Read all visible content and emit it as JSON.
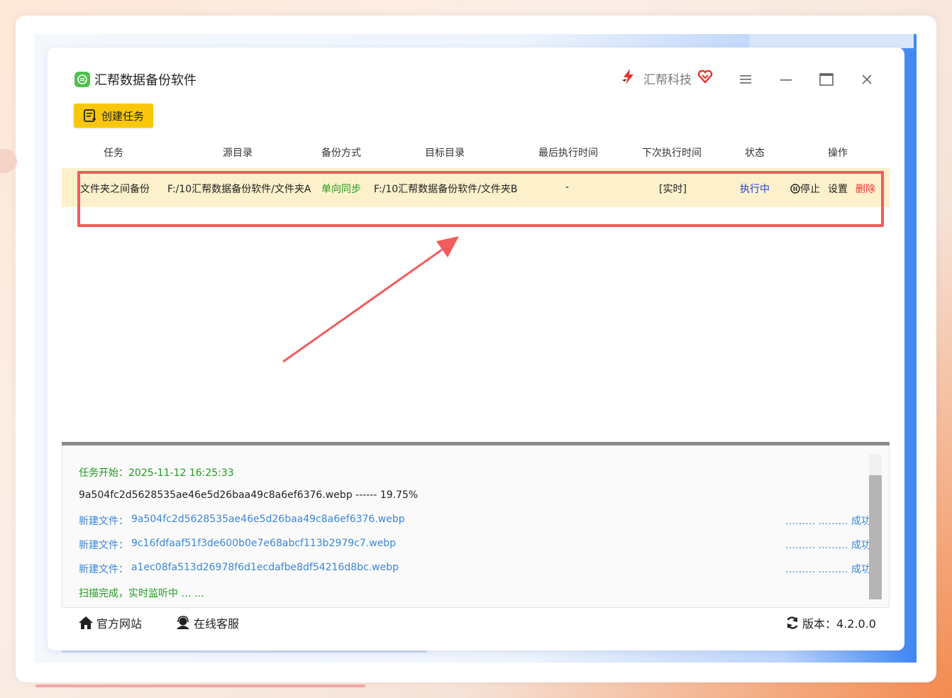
{
  "app": {
    "title": "汇帮数据备份软件",
    "brand": "汇帮科技"
  },
  "toolbar": {
    "create_task": "创建任务"
  },
  "table": {
    "headers": [
      "任务",
      "源目录",
      "备份方式",
      "目标目录",
      "最后执行时间",
      "下次执行时间",
      "状态",
      "操作"
    ],
    "rows": [
      {
        "task": "文件夹之间备份",
        "source": "F:/10汇帮数据备份软件/文件夹A",
        "mode": "单向同步",
        "target": "F:/10汇帮数据备份软件/文件夹B",
        "last_run": "-",
        "next_run": "[实时]",
        "status": "执行中",
        "actions": {
          "stop": "停止",
          "settings": "设置",
          "delete": "删除"
        }
      }
    ]
  },
  "log": {
    "start": "任务开始：2025-11-12 16:25:33",
    "progress": "9a504fc2d5628535ae46e5d26baa49c8a6ef6376.webp ------ 19.75%",
    "entries": [
      {
        "label": "新建文件：",
        "file": "9a504fc2d5628535ae46e5d26baa49c8a6ef6376.webp",
        "dots": "……… ……… ",
        "result": "成功"
      },
      {
        "label": "新建文件：",
        "file": "9c16fdfaaf51f3de600b0e7e68abcf113b2979c7.webp",
        "dots": "……… ……… ",
        "result": "成功"
      },
      {
        "label": "新建文件：",
        "file": "a1ec08fa513d26978f6d1ecdafbe8df54216d8bc.webp",
        "dots": "……… ……… ",
        "result": "成功"
      }
    ],
    "done": "扫描完成，实时监听中 … …"
  },
  "footer": {
    "website": "官方网站",
    "support": "在线客服",
    "version": "版本：4.2.0.0"
  },
  "colors": {
    "accent_yellow": "#f9c70a",
    "row_highlight": "#fdf1cc",
    "annotation_red": "#f15c5c",
    "success_green": "#1f9b1f",
    "link_blue": "#3a86d8",
    "delete_red": "#e53935",
    "status_blue": "#1d3fd8"
  }
}
